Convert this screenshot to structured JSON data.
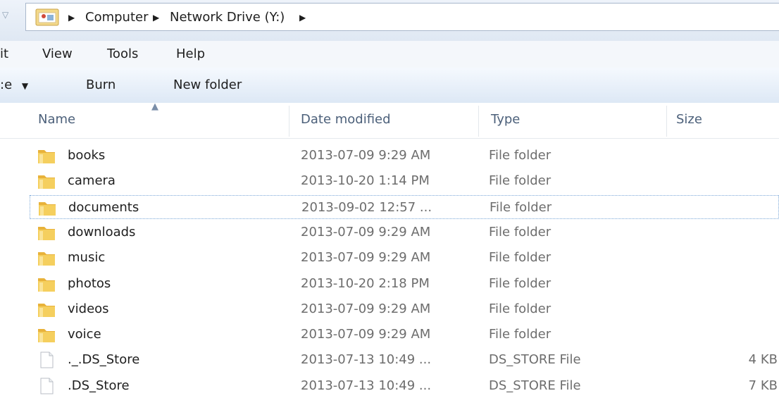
{
  "address_bar": {
    "breadcrumbs": [
      "Computer",
      "Network Drive (Y:)"
    ],
    "icon": "folder-icon"
  },
  "menu": {
    "items": [
      "it",
      "View",
      "Tools",
      "Help"
    ]
  },
  "toolbar": {
    "organize_label": ":e",
    "burn_label": "Burn",
    "new_folder_label": "New folder"
  },
  "columns": {
    "name": "Name",
    "date": "Date modified",
    "type": "Type",
    "size": "Size"
  },
  "files": [
    {
      "name": "books",
      "date": "2013-07-09 9:29 AM",
      "type": "File folder",
      "size": "",
      "icon": "folder-icon"
    },
    {
      "name": "camera",
      "date": "2013-10-20 1:14 PM",
      "type": "File folder",
      "size": "",
      "icon": "folder-icon"
    },
    {
      "name": "documents",
      "date": "2013-09-02 12:57 ...",
      "type": "File folder",
      "size": "",
      "icon": "folder-icon"
    },
    {
      "name": "downloads",
      "date": "2013-07-09 9:29 AM",
      "type": "File folder",
      "size": "",
      "icon": "folder-icon"
    },
    {
      "name": "music",
      "date": "2013-07-09 9:29 AM",
      "type": "File folder",
      "size": "",
      "icon": "folder-icon"
    },
    {
      "name": "photos",
      "date": "2013-10-20 2:18 PM",
      "type": "File folder",
      "size": "",
      "icon": "folder-icon"
    },
    {
      "name": "videos",
      "date": "2013-07-09 9:29 AM",
      "type": "File folder",
      "size": "",
      "icon": "folder-icon"
    },
    {
      "name": "voice",
      "date": "2013-07-09 9:29 AM",
      "type": "File folder",
      "size": "",
      "icon": "folder-icon"
    },
    {
      "name": "._.DS_Store",
      "date": "2013-07-13 10:49 ...",
      "type": "DS_STORE File",
      "size": "4 KB",
      "icon": "file-icon"
    },
    {
      "name": ".DS_Store",
      "date": "2013-07-13 10:49 ...",
      "type": "DS_STORE File",
      "size": "7 KB",
      "icon": "file-icon"
    }
  ],
  "colors": {
    "accent": "#7aa7d8",
    "folder_yellow": "#f2c24f",
    "header_text": "#4c607a"
  }
}
